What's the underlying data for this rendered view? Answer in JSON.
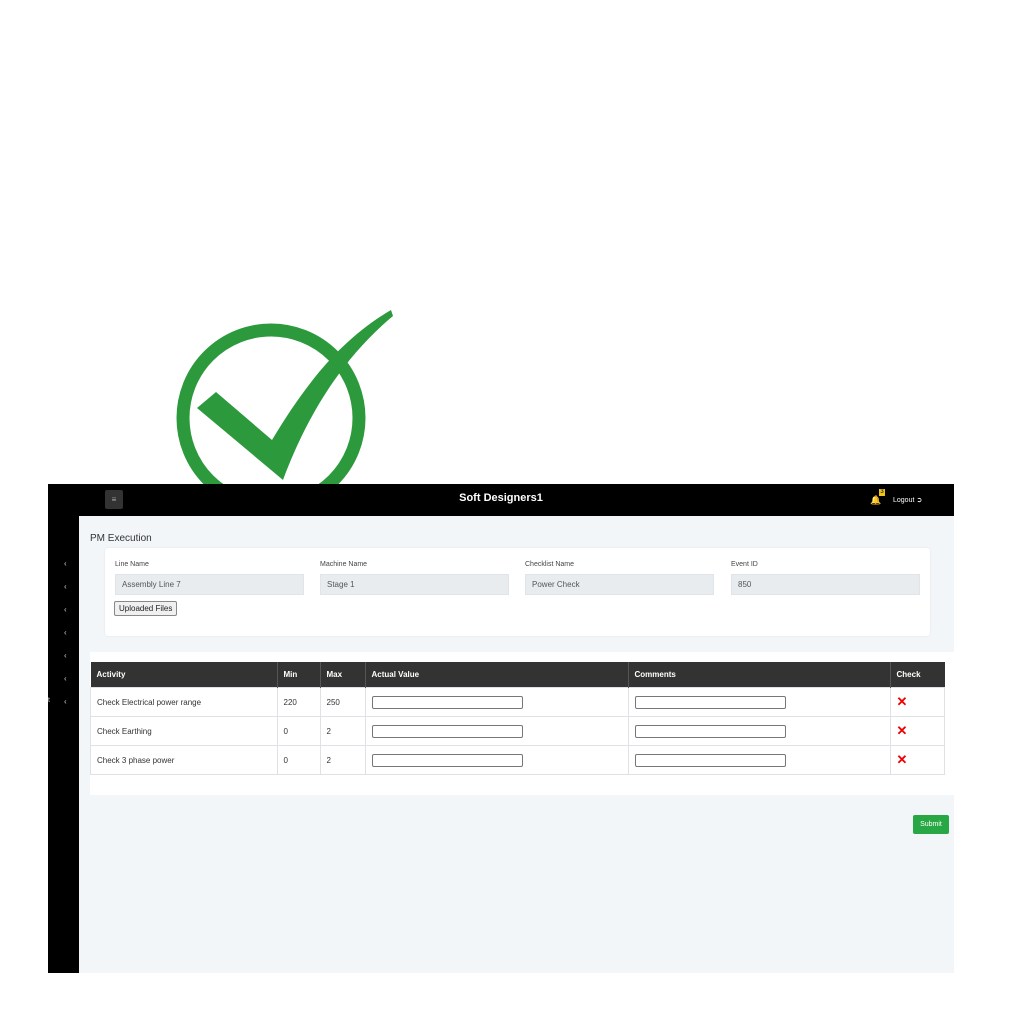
{
  "app": {
    "title": "Soft Designers1",
    "logout_label": "Logout",
    "notification_count": "3"
  },
  "page": {
    "title": "PM Execution"
  },
  "fields": [
    {
      "label": "Line Name",
      "value": "Assembly Line 7"
    },
    {
      "label": "Machine Name",
      "value": "Stage 1"
    },
    {
      "label": "Checklist Name",
      "value": "Power Check"
    },
    {
      "label": "Event ID",
      "value": "850"
    }
  ],
  "uploaded_files_label": "Uploaded Files",
  "table": {
    "headers": [
      "Activity",
      "Min",
      "Max",
      "Actual Value",
      "Comments",
      "Check"
    ],
    "rows": [
      {
        "activity": "Check Electrical power range",
        "min": "220",
        "max": "250",
        "actual": "",
        "comments": "",
        "check": "✕"
      },
      {
        "activity": "Check Earthing",
        "min": "0",
        "max": "2",
        "actual": "",
        "comments": "",
        "check": "✕"
      },
      {
        "activity": "Check 3 phase power",
        "min": "0",
        "max": "2",
        "actual": "",
        "comments": "",
        "check": "✕"
      }
    ]
  },
  "submit_label": "Submit",
  "sidebar_tiny_label": "t",
  "colors": {
    "checkmark": "#2c9a3c",
    "submit": "#28a745",
    "fail": "#ee0000",
    "header": "#000000"
  },
  "icons": {
    "menu": "menu-icon",
    "bell": "bell-icon",
    "logout": "logout-icon",
    "chevron": "chevron-left-icon",
    "check": "close-icon"
  }
}
